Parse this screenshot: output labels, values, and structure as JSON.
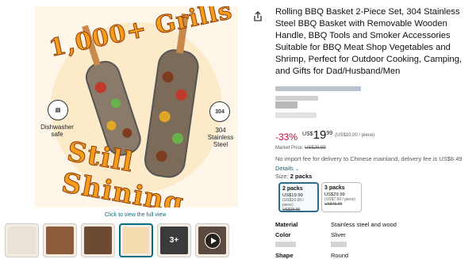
{
  "product": {
    "title": "Rolling BBQ Basket 2-Piece Set, 304 Stainless Steel BBQ Basket with Removable Wooden Handle, BBQ Tools and Smoker Accessories Suitable for BBQ Meat Shop Vegetables and Shrimp, Perfect for Outdoor Cooking, Camping, and Gifts for Dad/Husband/Men"
  },
  "image": {
    "promo_top": "1,000+ Grills",
    "promo_bottom": "Still Shining",
    "feature_left": "Dishwasher safe",
    "feature_right": "304 Stainless Steel",
    "feature_right_badge": "304",
    "view_full": "Click to view the full view",
    "more_count": "3+"
  },
  "price": {
    "discount": "-33%",
    "currency": "US$",
    "whole": "19",
    "fraction": "99",
    "per_unit": "(US$10.00 / piece)",
    "list_label": "Market Price:",
    "list_value": "US$29.99"
  },
  "shipping": {
    "import_fee": "No import fee for delivery to Chinese mainland, delivery fee is US$8.49",
    "details_label": "Details"
  },
  "size": {
    "label": "Size:",
    "selected": "2 packs",
    "options": [
      {
        "name": "2 packs",
        "price": "US$19.99",
        "unit": "(US$10.00 / piece)",
        "was": "US$29.99"
      },
      {
        "name": "3 packs",
        "price": "US$29.99",
        "unit": "(US$7.50 / piece)",
        "was": "US$45.00"
      }
    ]
  },
  "specs": [
    {
      "key": "Material",
      "value": "Stainless steel and wood"
    },
    {
      "key": "Color",
      "value": "Sliver"
    },
    {
      "key": "Shape",
      "value": "Round"
    }
  ],
  "colors": {
    "discount": "#cc0c39",
    "link": "#007185",
    "accent": "#f59c1a"
  }
}
